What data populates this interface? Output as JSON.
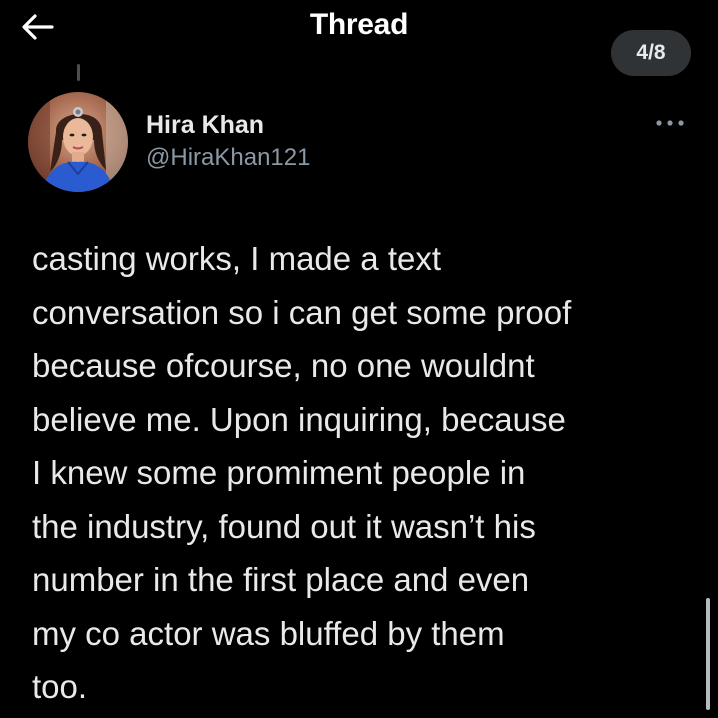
{
  "header": {
    "back_icon": "arrow-left-icon",
    "title": "Thread",
    "position_indicator": "4/8"
  },
  "author": {
    "display_name": "Hira Khan",
    "handle": "@HiraKhan121",
    "more_icon": "more-horizontal-icon"
  },
  "tweet": {
    "lines": [
      "casting works, I made a text",
      "conversation so i can get some proof",
      "because ofcourse, no one wouldnt",
      "believe me. Upon inquiring, because",
      "I knew some promiment people in",
      "the industry, found out it wasn’t his",
      "number in the first place and even",
      "my co actor was bluffed by them",
      "too."
    ]
  },
  "colors": {
    "background": "#000000",
    "primary_text": "#e7e9ea",
    "secondary_text": "#8b98a5",
    "pill_background": "#2f3336"
  }
}
